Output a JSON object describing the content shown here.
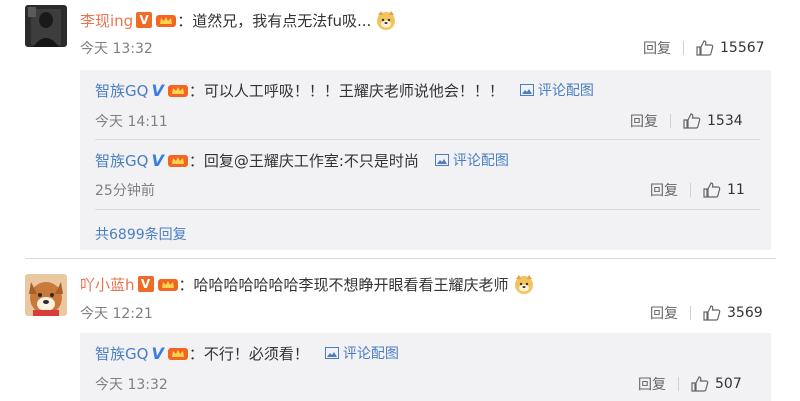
{
  "comments": [
    {
      "user": "李现ing",
      "text": "：道然兄，我有点无法fu吸...",
      "time": "今天 13:32",
      "reply_label": "回复",
      "likes": "15567",
      "replies": [
        {
          "user": "智族GQ",
          "text": "：可以人工呼吸！！！王耀庆老师说他会！！！",
          "pic_label": "评论配图",
          "time": "今天 14:11",
          "reply_label": "回复",
          "likes": "1534"
        },
        {
          "user": "智族GQ",
          "text_prefix": "：回复",
          "mention": "@王耀庆工作室",
          "text_suffix": ":不只是时尚",
          "pic_label": "评论配图",
          "time": "25分钟前",
          "reply_label": "回复",
          "likes": "11"
        }
      ],
      "more_replies": "共6899条回复"
    },
    {
      "user": "吖小蓝h",
      "text": "：哈哈哈哈哈哈哈李现不想睁开眼看看王耀庆老师",
      "time": "今天 12:21",
      "reply_label": "回复",
      "likes": "3569",
      "replies": [
        {
          "user": "智族GQ",
          "text": "：不行！必须看！",
          "pic_label": "评论配图",
          "time": "今天 13:32",
          "reply_label": "回复",
          "likes": "507"
        }
      ]
    }
  ],
  "icons": {
    "vip": "vip-v-badge",
    "blue_v": "blue-v-verified",
    "crown": "crown-icon",
    "emoji": "doge-emoji",
    "picture": "picture-icon",
    "like": "thumbs-up-icon"
  },
  "colors": {
    "username": "#eb7350",
    "link": "#4a7ec2",
    "panel": "#f2f2f5",
    "vip_badge": "#f06b25"
  }
}
